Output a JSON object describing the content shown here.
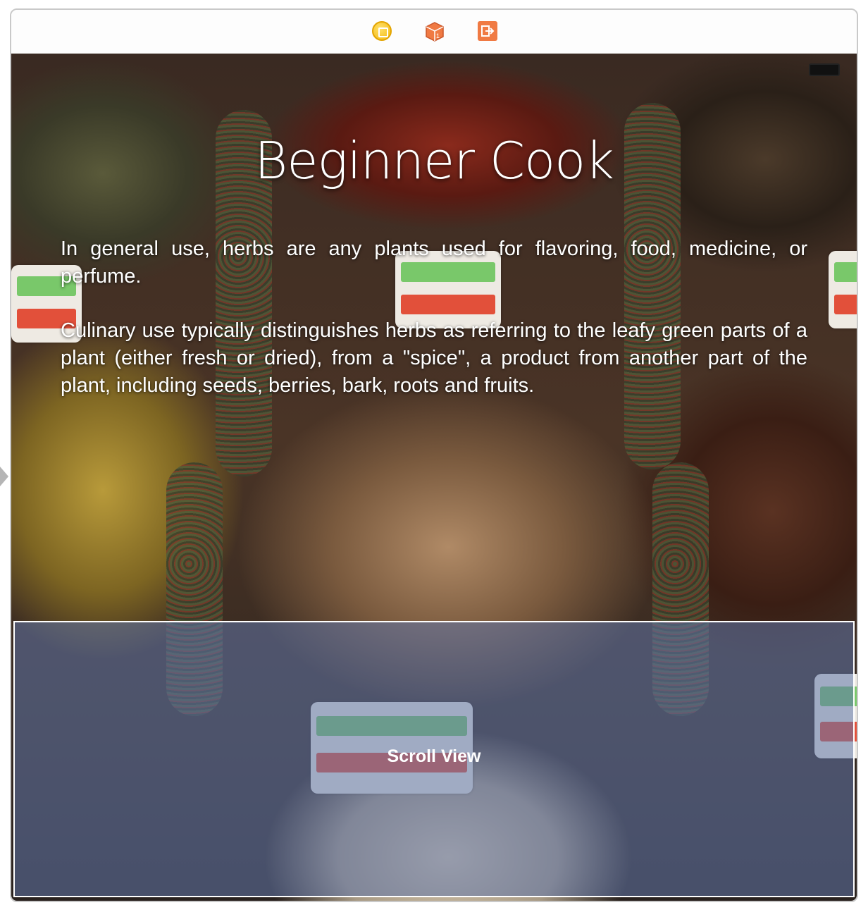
{
  "dock": {
    "icons": [
      "view-controller-icon",
      "first-responder-icon",
      "exit-icon"
    ],
    "colors": {
      "view_controller": "#f3b80d",
      "first_responder": "#f07a43",
      "exit": "#f07a43"
    }
  },
  "scene": {
    "title": "Beginner Cook",
    "paragraphs": [
      "In general use, herbs are any plants used for flavoring, food, medicine, or perfume.",
      "Culinary use typically distinguishes herbs as referring to the leafy green parts of a plant (either fresh or dried), from a \"spice\", a product from another part of the plant, including seeds, berries, bark, roots and fruits."
    ],
    "background": "spice-market-photo",
    "status_bar": {
      "icon": "battery-icon"
    }
  },
  "scroll_view": {
    "label": "Scroll View",
    "overlay_color": "#6076aa"
  },
  "canvas": {
    "entry_point": "segue-arrow-icon"
  }
}
